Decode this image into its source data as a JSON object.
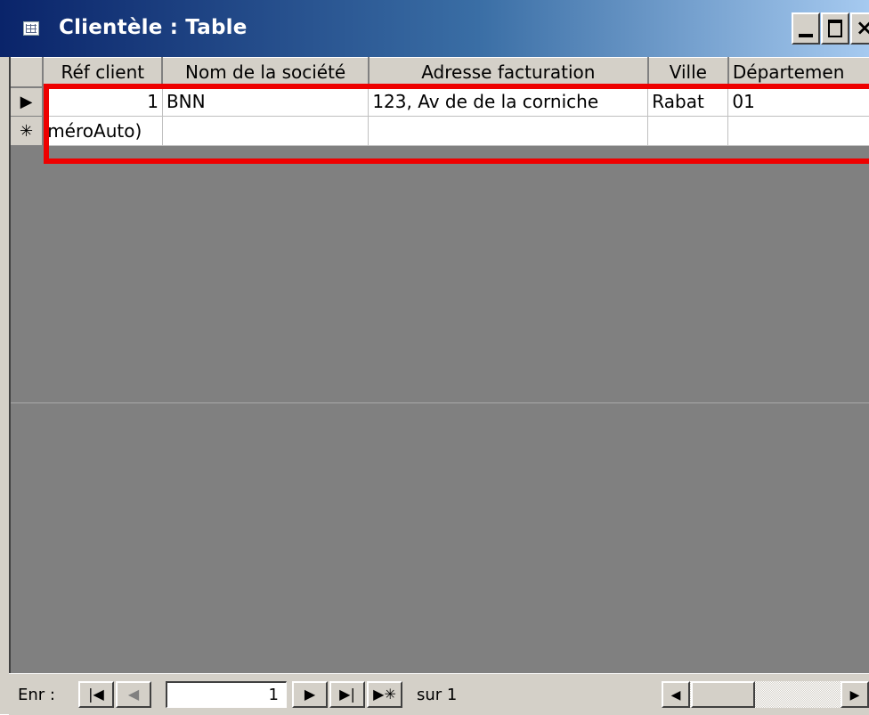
{
  "window": {
    "title": "Clientèle : Table",
    "minimize": "",
    "maximize": "",
    "close": "×"
  },
  "table": {
    "columns": [
      "Réf client",
      "Nom de la société",
      "Adresse facturation",
      "Ville",
      "Départemen"
    ],
    "rows": [
      {
        "selector": "▶",
        "cells": [
          "1",
          "BNN",
          "123, Av de de la corniche",
          "Rabat",
          "01"
        ]
      },
      {
        "selector": "✳",
        "cells": [
          "méroAuto)",
          "",
          "",
          "",
          ""
        ]
      }
    ]
  },
  "navigation": {
    "label": "Enr :",
    "first": "|◀",
    "prev": "◀",
    "current": "1",
    "next": "▶",
    "last": "▶|",
    "new": "▶✳",
    "total": "sur  1"
  },
  "scrollbar": {
    "left": "◀",
    "right": "▶"
  },
  "colors": {
    "highlight": "#ee0000",
    "titlebar": "#0a246a"
  }
}
